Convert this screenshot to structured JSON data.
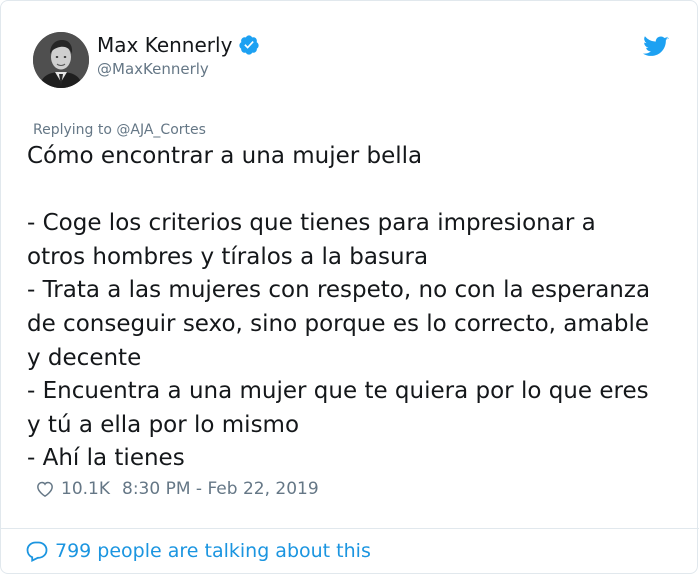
{
  "tweet": {
    "author": {
      "name": "Max Kennerly",
      "handle": "@MaxKennerly"
    },
    "replying_to": "Replying to @AJA_Cortes",
    "lines": [
      "Cómo encontrar a una mujer bella",
      "",
      "- Coge los criterios que tienes para impresionar a",
      "otros hombres y tíralos a la basura",
      "- Trata a las mujeres con respeto, no con la esperanza",
      "de conseguir sexo, sino porque es lo correcto, amable",
      "y decente",
      "- Encuentra a una mujer que te quiera por lo que eres",
      "y tú a ella por lo mismo",
      "- Ahí la tienes"
    ],
    "likes": "10.1K",
    "timestamp": "8:30 PM - Feb 22, 2019",
    "conversation": "799 people are talking about this"
  },
  "colors": {
    "text": "#14171a",
    "muted": "#657786",
    "accent": "#1da1f2",
    "link": "#1b95e0",
    "border": "#e1e8ed"
  },
  "icons": {
    "verified": "verified-badge-icon",
    "brand": "twitter-bird-icon",
    "like": "heart-icon",
    "conversation": "speech-bubble-icon"
  }
}
